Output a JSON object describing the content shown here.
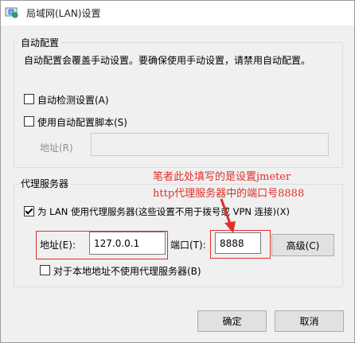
{
  "window": {
    "title": "局域网(LAN)设置",
    "icon": "globe-network-icon"
  },
  "auto_config": {
    "group_title": "自动配置",
    "description": "自动配置会覆盖手动设置。要确保使用手动设置，请禁用自动配置。",
    "auto_detect": {
      "label": "自动检测设置(A)",
      "checked": false
    },
    "use_script": {
      "label": "使用自动配置脚本(S)",
      "checked": false
    },
    "address_label": "地址(R)",
    "address_value": ""
  },
  "proxy": {
    "group_title": "代理服务器",
    "use_proxy": {
      "label": "为 LAN 使用代理服务器(这些设置不用于拨号或 VPN 连接)(X)",
      "checked": true
    },
    "address_label": "地址(E):",
    "address_value": "127.0.0.1",
    "port_label": "端口(T):",
    "port_value": "8888",
    "advanced_label": "高级(C)",
    "bypass_local": {
      "label": "对于本地地址不使用代理服务器(B)",
      "checked": false
    }
  },
  "annotation": {
    "line1": "笔者此处填写的是设置jmeter",
    "line2": "http代理服务器中的端口号8888",
    "color": "#e0302a"
  },
  "buttons": {
    "ok": "确定",
    "cancel": "取消"
  }
}
